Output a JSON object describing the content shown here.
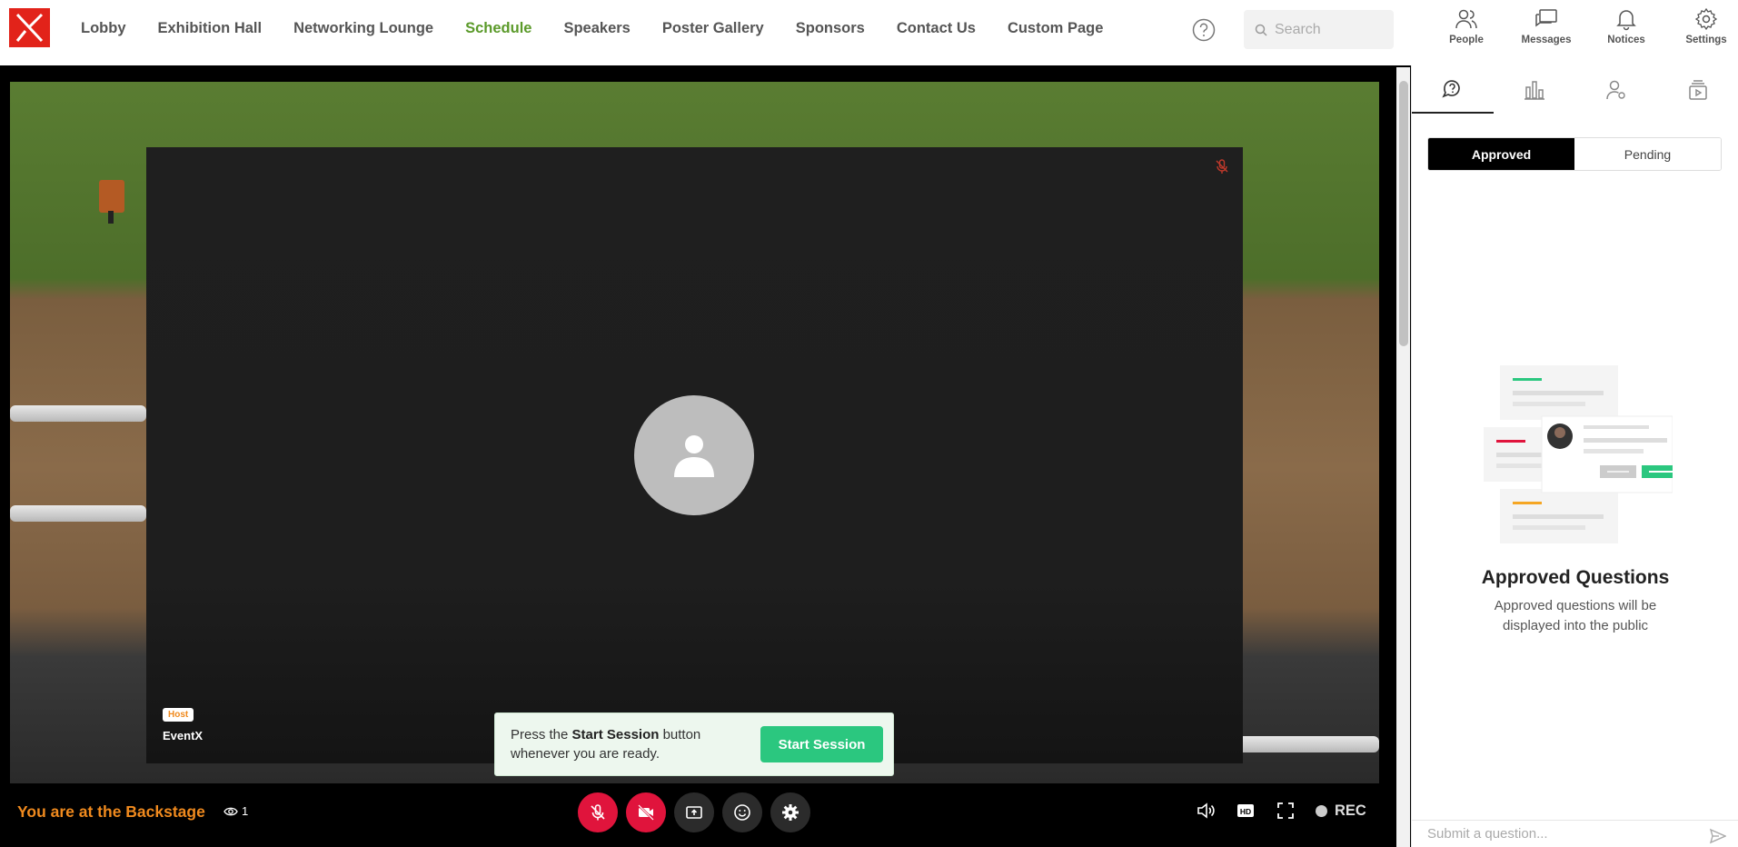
{
  "nav": {
    "items": [
      {
        "label": "Lobby",
        "active": false
      },
      {
        "label": "Exhibition Hall",
        "active": false
      },
      {
        "label": "Networking Lounge",
        "active": false
      },
      {
        "label": "Schedule",
        "active": true
      },
      {
        "label": "Speakers",
        "active": false
      },
      {
        "label": "Poster Gallery",
        "active": false
      },
      {
        "label": "Sponsors",
        "active": false
      },
      {
        "label": "Contact Us",
        "active": false
      },
      {
        "label": "Custom Page",
        "active": false
      }
    ],
    "search_placeholder": "Search",
    "icons": [
      {
        "label": "People",
        "icon": "people-icon"
      },
      {
        "label": "Messages",
        "icon": "messages-icon"
      },
      {
        "label": "Notices",
        "icon": "bell-icon"
      },
      {
        "label": "Settings",
        "icon": "gear-icon"
      }
    ]
  },
  "video": {
    "host_badge": "Host",
    "host_name": "EventX"
  },
  "toast": {
    "text_before": "Press the ",
    "text_bold": "Start Session",
    "text_after": " button whenever you are ready.",
    "button": "Start Session"
  },
  "bottom": {
    "location": "You are at the Backstage",
    "viewers": "1",
    "rec": "REC"
  },
  "panel": {
    "segments": {
      "approved": "Approved",
      "pending": "Pending"
    },
    "empty_title": "Approved Questions",
    "empty_desc": "Approved questions will be displayed into the public",
    "input_placeholder": "Submit a question..."
  },
  "colors": {
    "brand": "#e2231a",
    "active_nav": "#5b9a2a",
    "accent_green": "#2bc77f",
    "backstage_orange": "#f08a1e",
    "control_red": "#e0143c"
  }
}
